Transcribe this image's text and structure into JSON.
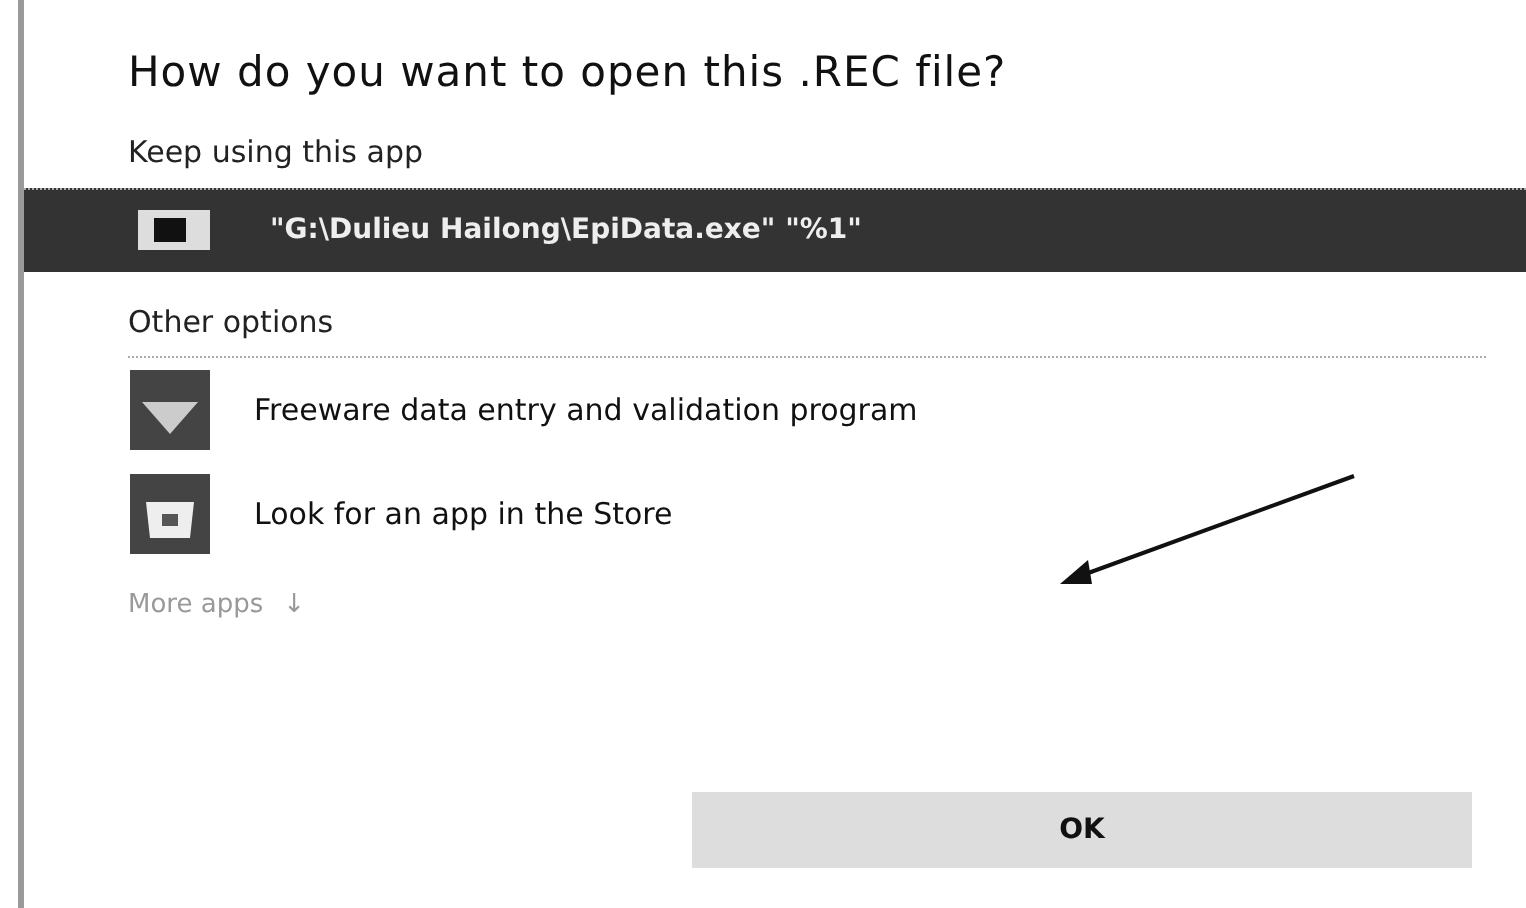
{
  "dialog": {
    "title": "How do you want to open this .REC file?",
    "current_section": {
      "heading": "Keep using this app",
      "app": {
        "label": "\"G:\\Dulieu Hailong\\EpiData.exe\" \"%1\"",
        "selected": true
      }
    },
    "other_section": {
      "heading": "Other options",
      "apps": [
        {
          "label": "Freeware data entry and validation program",
          "kind": "program",
          "selected": false
        },
        {
          "label": "Look for an app in the Store",
          "kind": "store",
          "selected": false
        }
      ]
    },
    "more_apps": {
      "label": "More apps",
      "arrow": "↓"
    },
    "ok_button": "OK"
  }
}
